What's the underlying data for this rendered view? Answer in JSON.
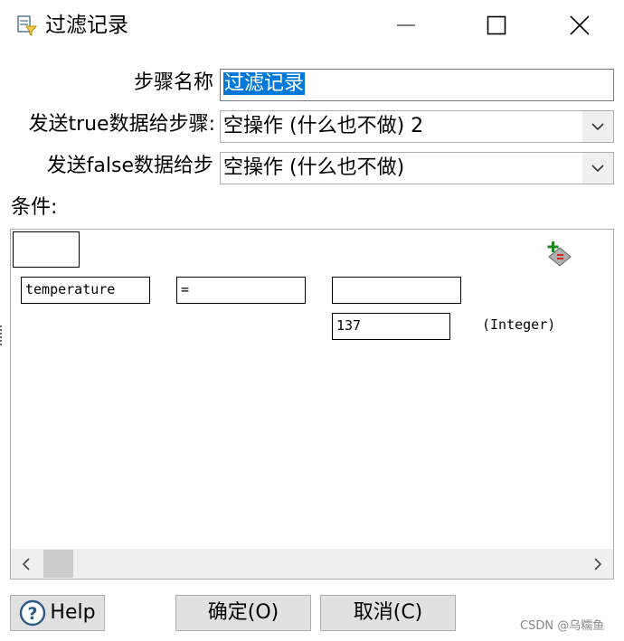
{
  "window": {
    "title": "过滤记录",
    "icon": "filter-rows-icon"
  },
  "form": {
    "step_name_label": "步骤名称",
    "step_name_value": "过滤记录",
    "send_true_label": "发送true数据给步骤:",
    "send_true_value": "空操作 (什么也不做) 2",
    "send_false_label": "发送false数据给步",
    "send_false_value": "空操作 (什么也不做)",
    "condition_label": "条件:"
  },
  "condition": {
    "field": "temperature",
    "operator": "=",
    "right_field": "",
    "constant": "137",
    "type": "(Integer)"
  },
  "buttons": {
    "help": "Help",
    "ok": "确定(O)",
    "cancel": "取消(C)"
  },
  "watermark": "CSDN @乌糯鱼",
  "colors": {
    "selection": "#0078d7",
    "button_bg": "#e1e1e1",
    "scrollbar_bg": "#f0f0f0"
  }
}
